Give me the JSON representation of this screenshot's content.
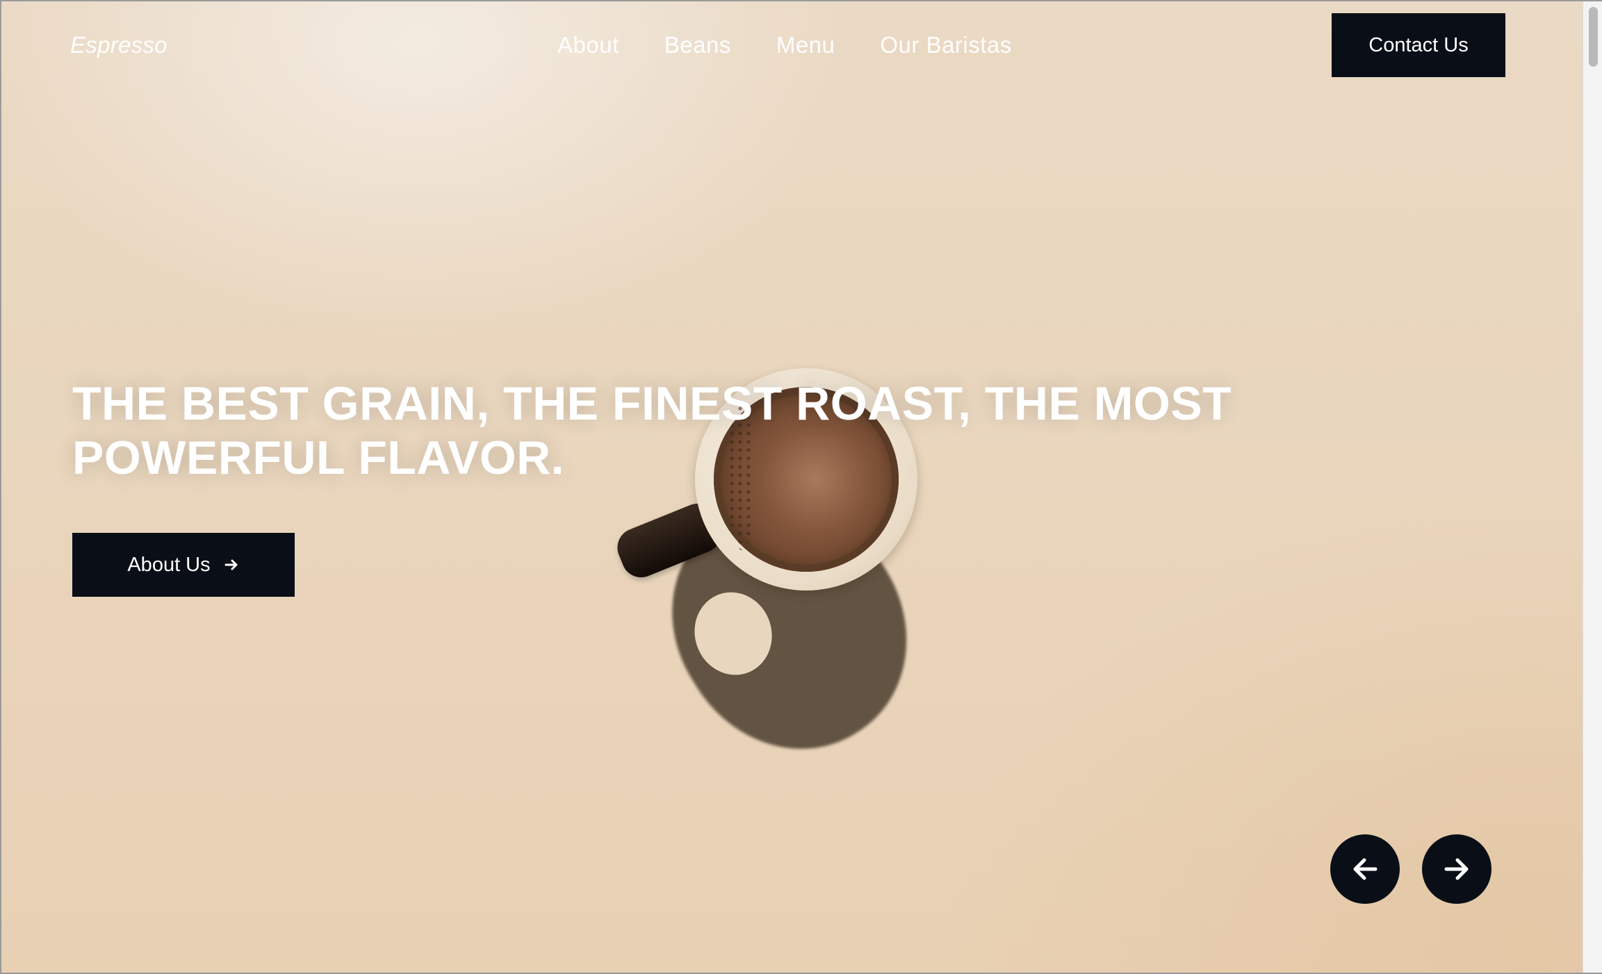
{
  "brand": "Espresso",
  "nav": {
    "items": [
      {
        "label": "About"
      },
      {
        "label": "Beans"
      },
      {
        "label": "Menu"
      },
      {
        "label": "Our Baristas"
      }
    ],
    "contact_label": "Contact Us"
  },
  "hero": {
    "headline": "THE BEST GRAIN, THE FINEST ROAST, THE MOST POWERFUL FLAVOR.",
    "cta_label": "About Us",
    "cta_icon": "arrow-right-icon",
    "prev_icon": "arrow-left-icon",
    "next_icon": "arrow-right-icon"
  },
  "colors": {
    "button_bg": "#0a0f17",
    "text_light": "#ffffff",
    "background": "#e9d6bf"
  }
}
